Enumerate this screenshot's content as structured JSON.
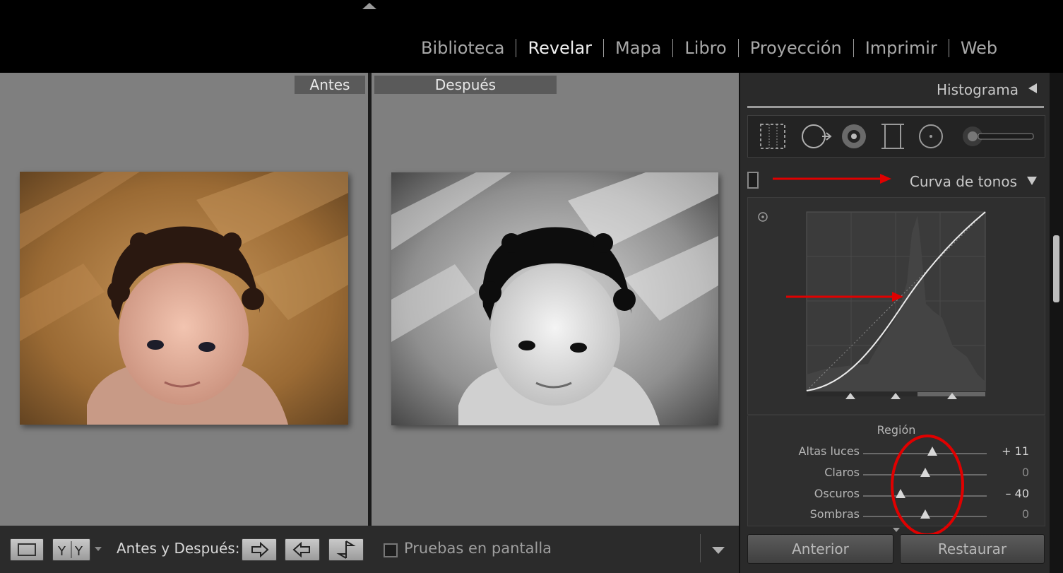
{
  "top": {
    "modules": [
      "Biblioteca",
      "Revelar",
      "Mapa",
      "Libro",
      "Proyección",
      "Imprimir",
      "Web"
    ],
    "active_module": "Revelar"
  },
  "viewer": {
    "label_before": "Antes",
    "label_after": "Después"
  },
  "bottom": {
    "before_after_label": "Antes y Después:",
    "proof_label": "Pruebas en pantalla",
    "proof_checked": false
  },
  "panel": {
    "histogram_title": "Histograma",
    "tone_curve_title": "Curva de tonos",
    "region_title": "Región",
    "sliders": [
      {
        "label": "Altas luces",
        "value": "+ 11",
        "level": 0.56
      },
      {
        "label": "Claros",
        "value": "0",
        "level": 0.5
      },
      {
        "label": "Oscuros",
        "value": "– 40",
        "level": 0.3
      },
      {
        "label": "Sombras",
        "value": "0",
        "level": 0.5
      }
    ],
    "button_previous": "Anterior",
    "button_reset": "Restaurar"
  },
  "colors": {
    "annotation_red": "#e00000",
    "panel_bg": "#2a2a2a",
    "viewer_bg": "#7f7f7f"
  }
}
